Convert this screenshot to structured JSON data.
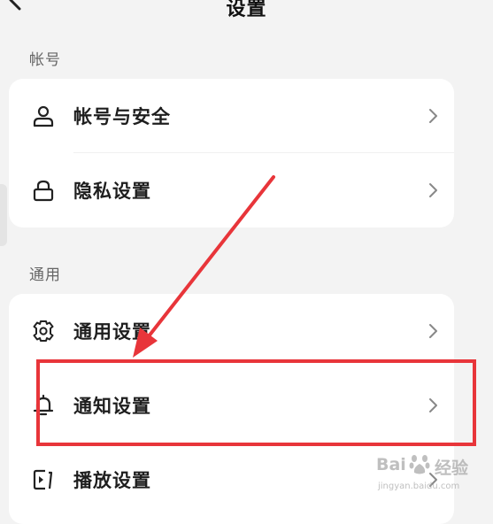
{
  "header": {
    "title": "设置"
  },
  "sections": [
    {
      "label": "帐号",
      "items": [
        {
          "label": "帐号与安全",
          "icon": "person-icon"
        },
        {
          "label": "隐私设置",
          "icon": "lock-icon"
        }
      ]
    },
    {
      "label": "通用",
      "items": [
        {
          "label": "通用设置",
          "icon": "gear-icon"
        },
        {
          "label": "通知设置",
          "icon": "bell-icon"
        },
        {
          "label": "播放设置",
          "icon": "play-settings-icon"
        }
      ]
    }
  ],
  "watermark": {
    "brand": "Bai",
    "cn": "经验",
    "url": "jingyan.baidu.com"
  },
  "colors": {
    "annotation": "#e8353a",
    "background": "#f3f3f3",
    "card": "#ffffff"
  }
}
